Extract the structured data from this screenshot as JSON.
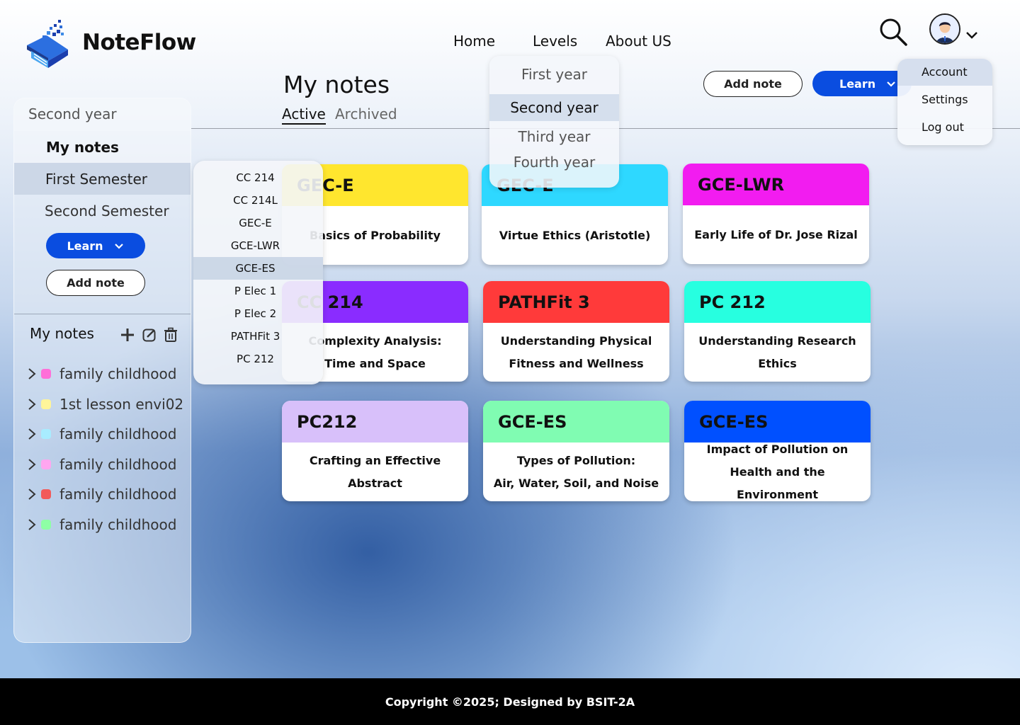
{
  "brand": {
    "name": "NoteFlow",
    "logo_icon": "book-pixel-logo"
  },
  "nav": {
    "home": "Home",
    "levels": "Levels",
    "about": "About US"
  },
  "page": {
    "title": "My notes",
    "tab_active": "Active",
    "tab_archived": "Archived"
  },
  "toolbar": {
    "add_note": "Add note",
    "learn": "Learn"
  },
  "account_menu": {
    "items": [
      "Account",
      "Settings",
      "Log out"
    ],
    "highlighted": "Account"
  },
  "levels_menu": {
    "items": [
      "First year",
      "Second year",
      "Third year",
      "Fourth year"
    ],
    "highlighted": "Second year"
  },
  "sidebar": {
    "level": "Second year",
    "my_notes": "My notes",
    "semesters": [
      "First Semester",
      "Second Semester"
    ],
    "learn": "Learn",
    "add_note": "Add note",
    "notes_title": "My notes",
    "tools": [
      "add-icon",
      "edit-icon",
      "trash-icon"
    ],
    "notes": [
      {
        "label": "family childhood",
        "color": "#ff6fd8"
      },
      {
        "label": "1st lesson envi02",
        "color": "#fff59a"
      },
      {
        "label": "family childhood",
        "color": "#a8ecff"
      },
      {
        "label": "family childhood",
        "color": "#ffa6f0"
      },
      {
        "label": "family childhood",
        "color": "#f25a5a"
      },
      {
        "label": "family childhood",
        "color": "#8effa5"
      }
    ]
  },
  "subject_menu": {
    "items": [
      "CC 214",
      "CC 214L",
      "GEC-E",
      "GCE-LWR",
      "GCE-ES",
      "P Elec 1",
      "P Elec 2",
      "PATHFit 3",
      "PC 212"
    ],
    "highlighted": "GCE-ES"
  },
  "cards": [
    {
      "subject": "GEC-E",
      "topic": "Basics of Probability",
      "color": "#ffe62e"
    },
    {
      "subject": "GEC-E",
      "topic": "Virtue Ethics (Aristotle)",
      "color": "#2ed8ff"
    },
    {
      "subject": "GCE-LWR",
      "topic": "Early Life of Dr. Jose Rizal",
      "color": "#f21cf0"
    },
    {
      "subject": "CC 214",
      "topic": "Complexity Analysis:\nTime and Space",
      "color": "#8a2cff"
    },
    {
      "subject": "PATHFit 3",
      "topic": "Understanding Physical\nFitness and Wellness",
      "color": "#ff3a3a"
    },
    {
      "subject": "PC 212",
      "topic": "Understanding Research\nEthics",
      "color": "#27ffe0"
    },
    {
      "subject": "PC212",
      "topic": "Crafting an Effective Abstract",
      "color": "#d8c0fa"
    },
    {
      "subject": "GCE-ES",
      "topic": "Types of Pollution:\nAir, Water, Soil, and Noise",
      "color": "#80fcb2"
    },
    {
      "subject": "GCE-ES",
      "topic": "Impact of Pollution on\nHealth and the Environment",
      "color": "#0050ff"
    }
  ],
  "footer": {
    "copyright": "Copyright ©2025; Designed by BSIT-2A"
  }
}
